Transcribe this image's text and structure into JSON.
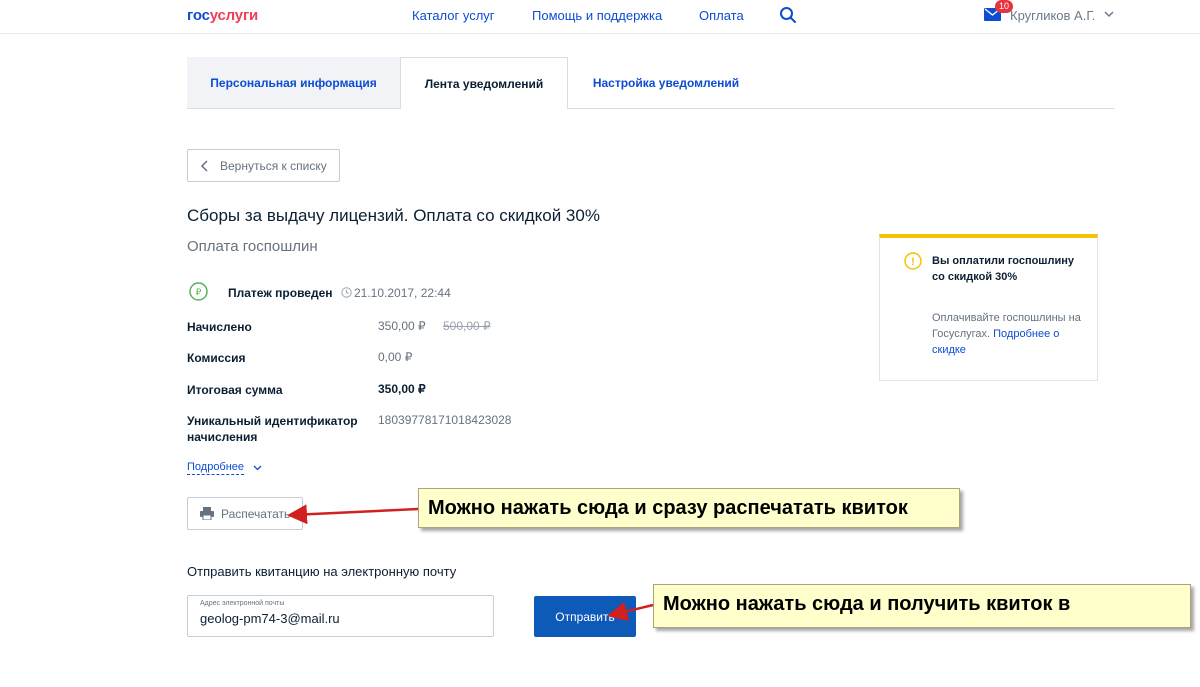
{
  "header": {
    "logo_part1": "гос",
    "logo_part2": "услуги",
    "nav": [
      "Каталог услуг",
      "Помощь и поддержка",
      "Оплата"
    ],
    "mail_count": "10",
    "user_name": "Кругликов А.Г."
  },
  "tabs": [
    "Персональная информация",
    "Лента уведомлений",
    "Настройка уведомлений"
  ],
  "back_label": "Вернуться к списку",
  "title": "Сборы за выдачу лицензий. Оплата со скидкой 30%",
  "subtitle": "Оплата госпошлин",
  "status": {
    "icon_text": "₽",
    "label": "Платеж проведен",
    "time": "21.10.2017, 22:44"
  },
  "details": [
    {
      "label": "Начислено",
      "value": "350,00 ₽",
      "old_value": "500,00 ₽"
    },
    {
      "label": "Комиссия",
      "value": "0,00 ₽"
    },
    {
      "label": "Итоговая сумма",
      "value": "350,00 ₽"
    },
    {
      "label_line1": "Уникальный идентификатор",
      "label_line2": "начисления",
      "value": "18039778171018423028"
    }
  ],
  "more_label": "Подробнее",
  "print_label": "Распечатать",
  "email": {
    "heading": "Отправить квитанцию на электронную почту",
    "field_label": "Адрес электронной почты",
    "value": "geolog-pm74-3@mail.ru",
    "send_label": "Отправить"
  },
  "info_card": {
    "icon_text": "!",
    "title": "Вы оплатили госпошлину со скидкой 30%",
    "text": "Оплачивайте госпошлины на Госуслугах.",
    "link": "Подробнее о скидке"
  },
  "annotations": {
    "print": "Можно нажать сюда и сразу распечатать квиток",
    "send": "Можно нажать сюда и получить квиток в"
  },
  "colors": {
    "brand_blue": "#0d4cd3",
    "brand_red": "#ee3f58",
    "button_blue": "#0d5ab9",
    "card_accent": "#f5c200",
    "status_green": "#5bb25a",
    "annotation_bg": "#ffffcc",
    "arrow_red": "#d21f1f"
  }
}
